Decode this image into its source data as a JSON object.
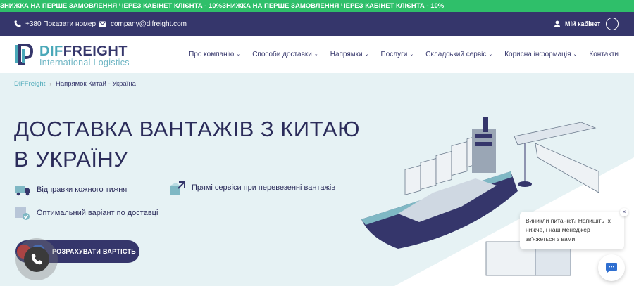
{
  "promo": {
    "text": "ЗНИЖКА НА ПЕРШЕ ЗАМОВЛЕННЯ ЧЕРЕЗ КАБІНЕТ КЛІЄНТА - 10%ЗНИЖКА НА ПЕРШЕ ЗАМОВЛЕННЯ ЧЕРЕЗ КАБІНЕТ КЛІЄНТА - 10%"
  },
  "topbar": {
    "phone": "+380 Показати номер",
    "email": "company@difreight.com",
    "cabinet": "Мій кабінет"
  },
  "logo": {
    "brand_d": "DIF",
    "brand_f": "FREIGHT",
    "tagline": "International Logistics"
  },
  "nav": {
    "items": [
      {
        "label": "Про компанію"
      },
      {
        "label": "Способи доставки"
      },
      {
        "label": "Напрямки"
      },
      {
        "label": "Послуги"
      },
      {
        "label": "Складський сервіс"
      },
      {
        "label": "Корисна інформація"
      },
      {
        "label": "Контакти"
      }
    ]
  },
  "breadcrumb": {
    "home": "DiFFreight",
    "current": "Напрямок Китай - Україна"
  },
  "hero": {
    "title_line1": "ДОСТАВКА ВАНТАЖІВ З КИТАЮ",
    "title_line2": "В УКРАЇНУ",
    "features": [
      "Відправки кожного тижня",
      "Прямі сервіси при перевезенні вантажів",
      "Оптимальний варіант по доставці"
    ],
    "cta": "РОЗРАХУВАТИ ВАРТІСТЬ"
  },
  "chat": {
    "message": "Виникли питання? Напишіть їх нижче, і наш менеджер зв'яжеться з вами.",
    "close": "×"
  },
  "colors": {
    "primary": "#35366b",
    "accent": "#4aa8b8",
    "promo": "#2fbf6a",
    "hero_bg": "#e6f2f4"
  }
}
